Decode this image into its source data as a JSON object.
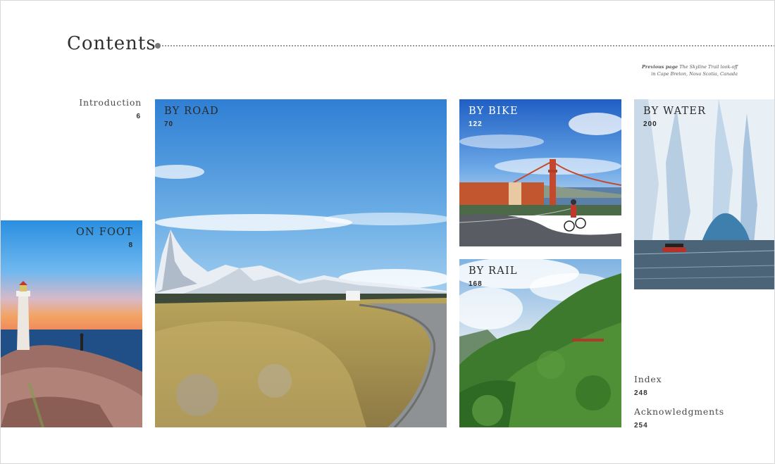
{
  "page_title": "Contents",
  "caption": {
    "lead": "Previous page",
    "text": "The Skyline Trail look-off in Cape Breton, Nova Scotia, Canada"
  },
  "sections": {
    "introduction": {
      "label": "Introduction",
      "page": "6"
    },
    "on_foot": {
      "label": "ON FOOT",
      "page": "8"
    },
    "by_road": {
      "label": "BY ROAD",
      "page": "70"
    },
    "by_bike": {
      "label": "BY BIKE",
      "page": "122"
    },
    "by_rail": {
      "label": "BY RAIL",
      "page": "168"
    },
    "by_water": {
      "label": "BY WATER",
      "page": "200"
    },
    "index": {
      "label": "Index",
      "page": "248"
    },
    "acknowledgments": {
      "label": "Acknowledgments",
      "page": "254"
    }
  },
  "images": {
    "on_foot": "lighthouse-at-sunset",
    "by_road": "mountain-road-patagonia",
    "by_bike": "cyclist-golden-gate-bridge",
    "by_rail": "train-through-forested-mountains",
    "by_water": "glacier-with-boat"
  }
}
